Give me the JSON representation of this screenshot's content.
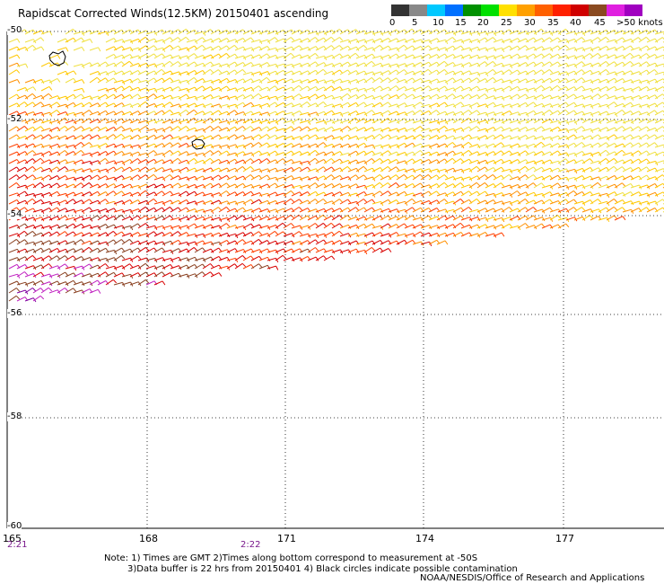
{
  "title": "Rapidscat Corrected Winds(12.5KM) 20150401 ascending",
  "legend": {
    "colors": [
      "#333333",
      "#888888",
      "#00c8ff",
      "#0070ff",
      "#009000",
      "#00e000",
      "#ffe000",
      "#ffa000",
      "#ff6000",
      "#ff2000",
      "#d00000",
      "#8a4a20",
      "#e020e0",
      "#a000c0",
      "#600090"
    ],
    "labels": [
      "0",
      "5",
      "10",
      "15",
      "20",
      "25",
      "30",
      "35",
      "40",
      "45",
      ">50 knots"
    ]
  },
  "longitudes": [
    "165",
    "168",
    "171",
    "174",
    "177"
  ],
  "latitudes": [
    "-50",
    "-52",
    "-54",
    "-56",
    "-58",
    "-60"
  ],
  "times": [
    "2:21",
    "2:22"
  ],
  "notes": [
    "Note: 1) Times are GMT 2)Times along bottom correspond to measurement at -50S",
    "3)Data buffer is 22 hrs from 20150401 4) Black circles indicate possible contamination"
  ],
  "credit": "NOAA/NESDIS/Office of Research and Applications"
}
